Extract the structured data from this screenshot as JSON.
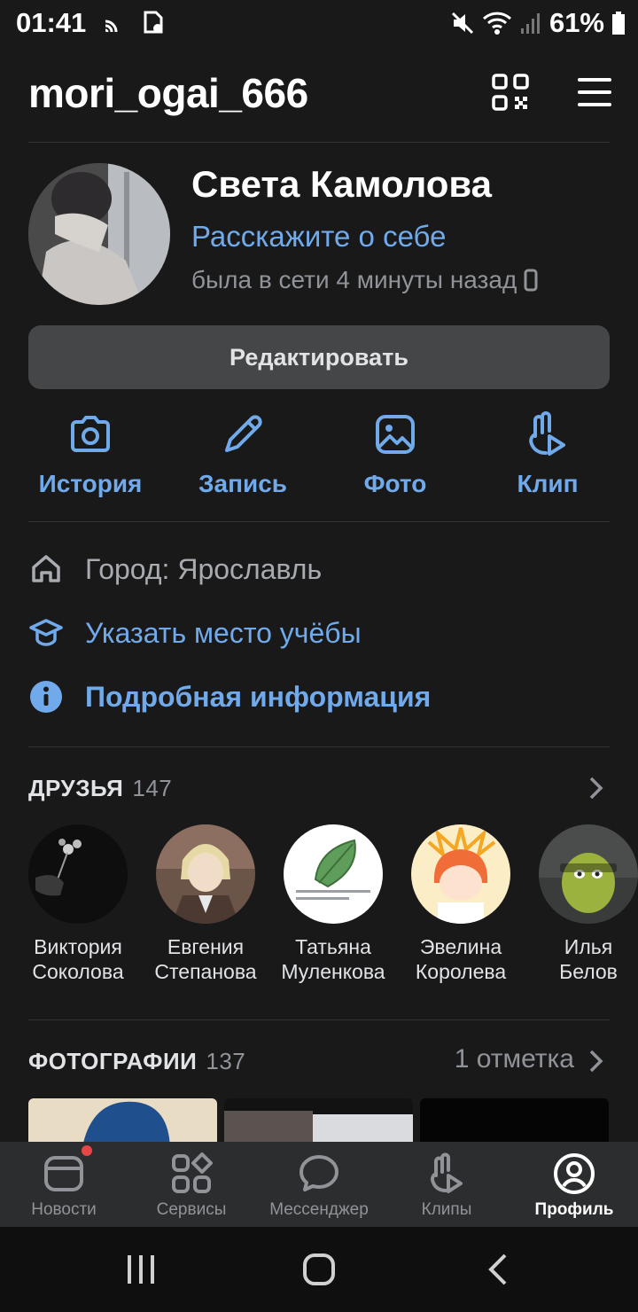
{
  "status_bar": {
    "time": "01:41",
    "battery": "61%"
  },
  "header": {
    "username": "mori_ogai_666"
  },
  "profile": {
    "name": "Света Камолова",
    "about_link": "Расскажите о себе",
    "last_seen": "была в сети 4 минуты назад",
    "edit_label": "Редактировать"
  },
  "actions": [
    {
      "label": "История",
      "icon": "camera-icon"
    },
    {
      "label": "Запись",
      "icon": "pencil-icon"
    },
    {
      "label": "Фото",
      "icon": "image-icon"
    },
    {
      "label": "Клип",
      "icon": "clip-icon"
    }
  ],
  "info": {
    "city": "Город: Ярославль",
    "education": "Указать место учёбы",
    "details": "Подробная информация"
  },
  "friends": {
    "title": "ДРУЗЬЯ",
    "count": "147",
    "items": [
      {
        "first": "Виктория",
        "last": "Соколова"
      },
      {
        "first": "Евгения",
        "last": "Степанова"
      },
      {
        "first": "Татьяна",
        "last": "Муленкова"
      },
      {
        "first": "Эвелина",
        "last": "Королева"
      },
      {
        "first": "Илья",
        "last": "Белов"
      }
    ]
  },
  "photos": {
    "title": "ФОТОГРАФИИ",
    "count": "137",
    "tag": "1 отметка"
  },
  "tabbar": [
    {
      "label": "Новости",
      "icon": "news-icon"
    },
    {
      "label": "Сервисы",
      "icon": "services-icon"
    },
    {
      "label": "Мессенджер",
      "icon": "messenger-icon"
    },
    {
      "label": "Клипы",
      "icon": "clips-icon"
    },
    {
      "label": "Профиль",
      "icon": "profile-icon"
    }
  ],
  "colors": {
    "accent": "#71aaeb",
    "background": "#19191a",
    "tabbar": "#2c2d2e",
    "badge": "#e64646"
  }
}
